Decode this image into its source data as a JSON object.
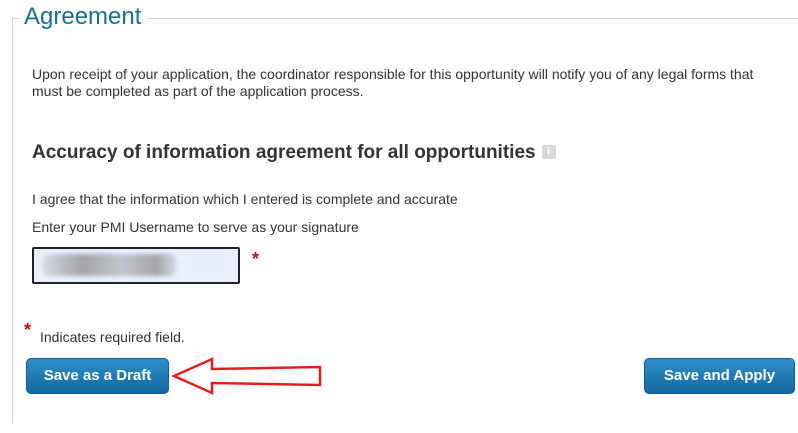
{
  "section": {
    "legend": "Agreement",
    "intro": "Upon receipt of your application, the coordinator responsible for this opportunity will notify you of any legal forms that must be completed as part of the application process."
  },
  "accuracy": {
    "title": "Accuracy of information agreement for all opportunities",
    "info_icon": "info-icon",
    "agree_text": "I agree that the information which I entered is complete and accurate",
    "signature_label": "Enter your PMI Username to serve as your signature",
    "signature_value": ""
  },
  "required": {
    "star": "*",
    "note": "Indicates required field."
  },
  "buttons": {
    "draft": "Save as a Draft",
    "apply": "Save and Apply"
  },
  "colors": {
    "legend": "#1a6e8e",
    "required": "#d0021b",
    "button": "#1a74b0",
    "arrow": "#e02020",
    "input_bg": "#e8f0fe"
  }
}
